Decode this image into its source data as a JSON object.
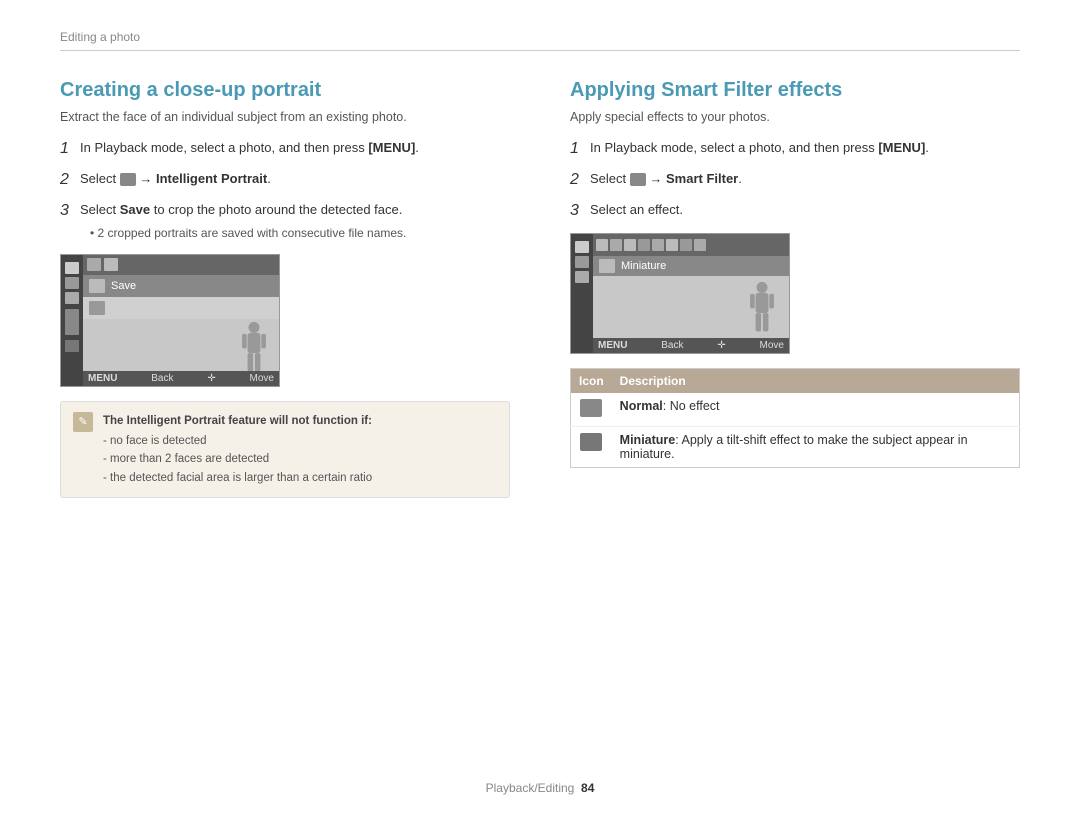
{
  "page": {
    "breadcrumb": "Editing a photo",
    "footer": "Playback/Editing",
    "footer_page": "84"
  },
  "left_section": {
    "title": "Creating a close-up portrait",
    "subtitle": "Extract the face of an individual subject from an existing photo.",
    "steps": [
      {
        "num": "1",
        "text": "In Playback mode, select a photo, and then press [MENU]."
      },
      {
        "num": "2",
        "text_prefix": "Select ",
        "text_icon": "icon",
        "text_suffix": " → Intelligent Portrait."
      },
      {
        "num": "3",
        "text_prefix": "Select Save to crop the photo around the detected face.",
        "bullet": "2 cropped portraits are saved with consecutive file names."
      }
    ],
    "camera": {
      "menu_label": "MENU",
      "back_label": "Back",
      "move_label": "Move",
      "save_label": "Save"
    },
    "note": {
      "title": "The Intelligent Portrait feature will not function if:",
      "items": [
        "no face is detected",
        "more than 2 faces are detected",
        "the detected facial area is larger than a certain ratio"
      ]
    }
  },
  "right_section": {
    "title": "Applying Smart Filter effects",
    "subtitle": "Apply special effects to your photos.",
    "steps": [
      {
        "num": "1",
        "text": "In Playback mode, select a photo, and then press [MENU]."
      },
      {
        "num": "2",
        "text_prefix": "Select ",
        "text_suffix": " → Smart Filter."
      },
      {
        "num": "3",
        "text": "Select an effect."
      }
    ],
    "camera": {
      "menu_label": "MENU",
      "back_label": "Back",
      "move_label": "Move",
      "miniature_label": "Miniature"
    },
    "table": {
      "headers": [
        "Icon",
        "Description"
      ],
      "rows": [
        {
          "icon_label": "normal-icon",
          "description_bold": "Normal",
          "description_rest": ": No effect"
        },
        {
          "icon_label": "miniature-icon",
          "description_bold": "Miniature",
          "description_rest": ": Apply a tilt-shift effect to make the subject appear in miniature."
        }
      ]
    }
  }
}
